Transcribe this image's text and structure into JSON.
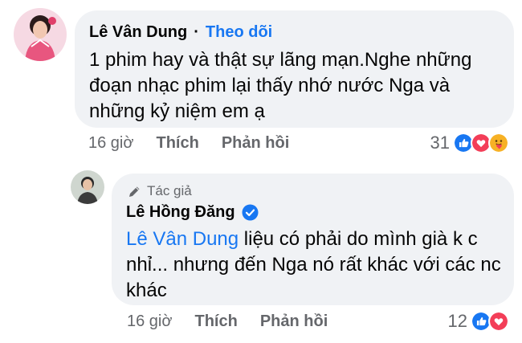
{
  "comment1": {
    "author": "Lê Vân Dung",
    "separator": "·",
    "follow_label": "Theo dõi",
    "text": "1 phim hay và thật sự lãng mạn.Nghe những đoạn nhạc phim lại thấy nhớ nước Nga và những kỷ niệm em ạ",
    "time": "16 giờ",
    "like_label": "Thích",
    "reply_label": "Phản hồi",
    "reaction_count": "31",
    "reaction_icons": [
      "like-icon",
      "love-icon",
      "care-icon"
    ]
  },
  "reply1": {
    "author_tag": "Tác giả",
    "author": "Lê Hồng Đăng",
    "mention": "Lê Vân Dung",
    "text": " liệu có phải do mình già k c nhỉ... nhưng đến Nga nó rất khác với các nc khác",
    "time": "16 giờ",
    "like_label": "Thích",
    "reply_label": "Phản hồi",
    "reaction_count": "12",
    "reaction_icons": [
      "like-icon",
      "love-icon"
    ]
  },
  "colors": {
    "bubble": "#f0f2f5",
    "link": "#1877f2",
    "secondary_text": "#65676b",
    "like": "#1877f2",
    "love": "#f33e58",
    "care": "#f7b125"
  }
}
